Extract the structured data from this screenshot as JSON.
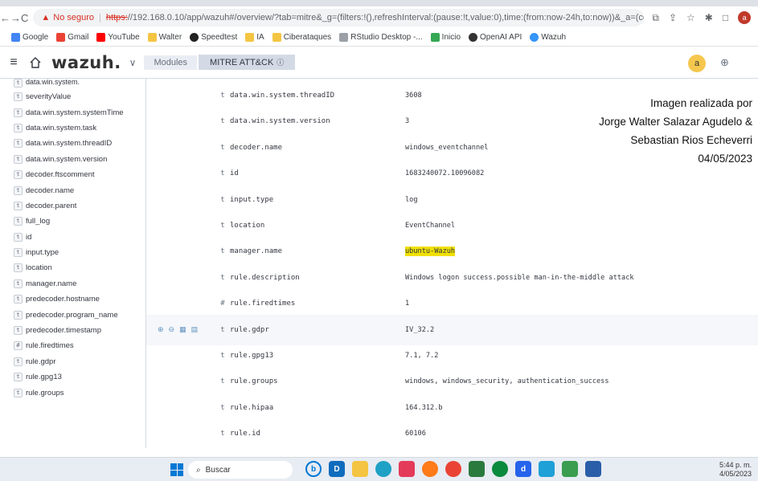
{
  "browser": {
    "security_label": "No seguro",
    "url_protocol": "https:",
    "url_rest": "//192.168.0.10/app/wazuh#/overview/?tab=mitre&_g=(filters:!(),refreshInterval:(pause:!t,value:0),time:(from:now-24h,to:now))&_a=(column...",
    "bookmarks": [
      "Google",
      "Gmail",
      "YouTube",
      "Walter",
      "Speedtest",
      "IA",
      "Ciberataques",
      "RStudio Desktop -...",
      "Inicio",
      "OpenAI API",
      "Wazuh"
    ],
    "profile_initial": "a"
  },
  "header": {
    "logo": "wazuh.",
    "crumb_modules": "Modules",
    "crumb_current": "MITRE ATT&CK",
    "avatar_initial": "a"
  },
  "sidebar": {
    "fields": [
      {
        "type": "t",
        "name": "severityValue"
      },
      {
        "type": "t",
        "name": "data.win.system.systemTime"
      },
      {
        "type": "t",
        "name": "data.win.system.task"
      },
      {
        "type": "t",
        "name": "data.win.system.threadID"
      },
      {
        "type": "t",
        "name": "data.win.system.version"
      },
      {
        "type": "t",
        "name": "decoder.ftscomment"
      },
      {
        "type": "t",
        "name": "decoder.name"
      },
      {
        "type": "t",
        "name": "decoder.parent"
      },
      {
        "type": "t",
        "name": "full_log"
      },
      {
        "type": "t",
        "name": "id"
      },
      {
        "type": "t",
        "name": "input.type"
      },
      {
        "type": "t",
        "name": "location"
      },
      {
        "type": "t",
        "name": "manager.name"
      },
      {
        "type": "t",
        "name": "predecoder.hostname"
      },
      {
        "type": "t",
        "name": "predecoder.program_name"
      },
      {
        "type": "t",
        "name": "predecoder.timestamp"
      },
      {
        "type": "#",
        "name": "rule.firedtimes"
      },
      {
        "type": "t",
        "name": "rule.gdpr"
      },
      {
        "type": "t",
        "name": "rule.gpg13"
      },
      {
        "type": "t",
        "name": "rule.groups"
      }
    ],
    "partial_top": "data.win.system."
  },
  "document": {
    "rows": [
      {
        "type": "t",
        "field": "data.win.system.threadID",
        "value": "3608"
      },
      {
        "type": "t",
        "field": "data.win.system.version",
        "value": "3"
      },
      {
        "type": "t",
        "field": "decoder.name",
        "value": "windows_eventchannel"
      },
      {
        "type": "t",
        "field": "id",
        "value": "1683240072.10096082"
      },
      {
        "type": "t",
        "field": "input.type",
        "value": "log"
      },
      {
        "type": "t",
        "field": "location",
        "value": "EventChannel"
      },
      {
        "type": "t",
        "field": "manager.name",
        "value": "ubuntu-Wazuh"
      },
      {
        "type": "t",
        "field": "rule.description",
        "value": "Windows logon success.possible man-in-the-middle attack"
      },
      {
        "type": "#",
        "field": "rule.firedtimes",
        "value": "1"
      },
      {
        "type": "t",
        "field": "rule.gdpr",
        "value": "IV_32.2"
      },
      {
        "type": "t",
        "field": "rule.gpg13",
        "value": "7.1, 7.2"
      },
      {
        "type": "t",
        "field": "rule.groups",
        "value": "windows, windows_security, authentication_success"
      },
      {
        "type": "t",
        "field": "rule.hipaa",
        "value": "164.312.b"
      },
      {
        "type": "t",
        "field": "rule.id",
        "value": "60106"
      }
    ]
  },
  "overlay": {
    "line1": "Imagen realizada por",
    "line2": "Jorge Walter Salazar Agudelo &",
    "line3": "Sebastian Rios Echeverri",
    "line4": "04/05/2023"
  },
  "taskbar": {
    "search_placeholder": "Buscar",
    "time": "5:44 p. m.",
    "date": "4/05/2023"
  }
}
